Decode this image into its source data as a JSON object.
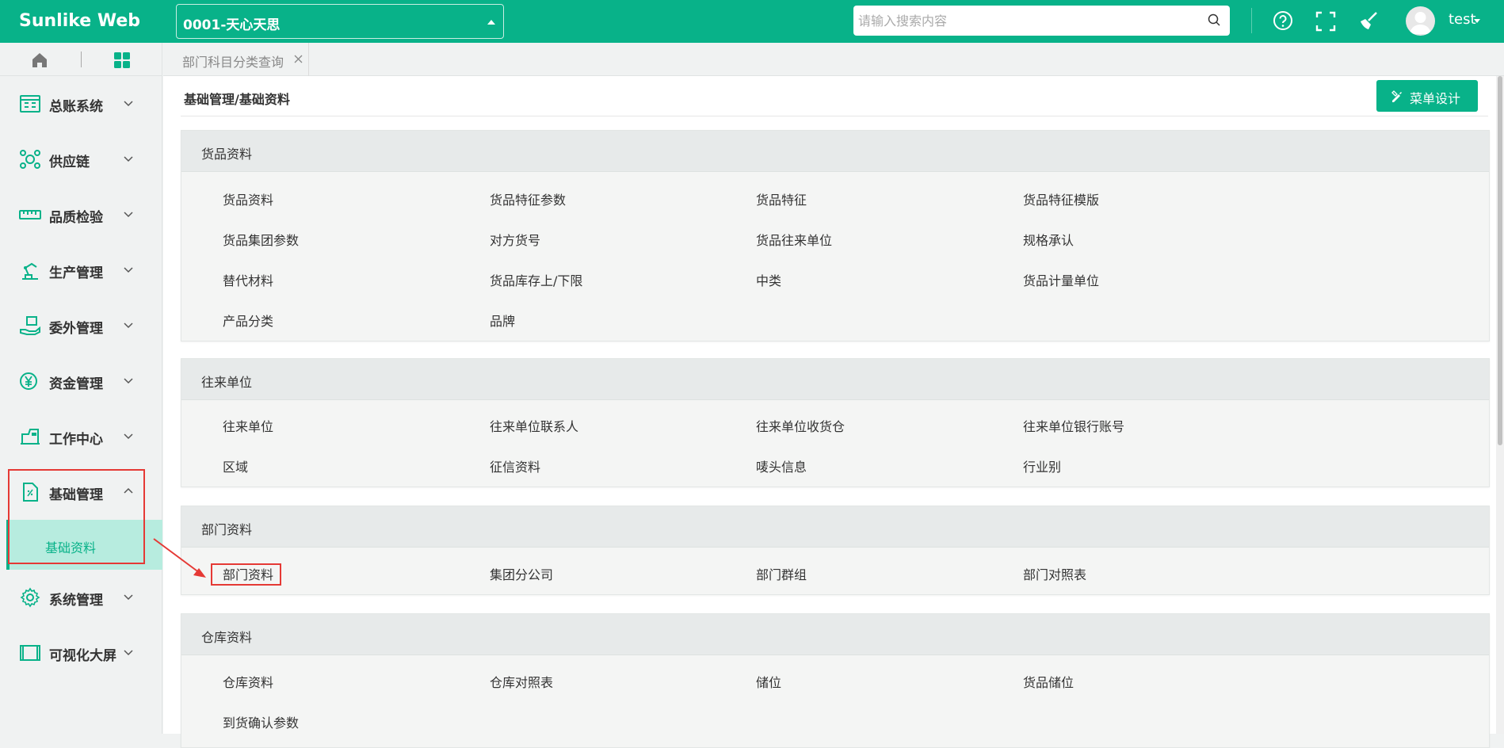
{
  "header": {
    "logo": "Sunlike Web",
    "org_select": "0001-天心天思",
    "search_placeholder": "请输入搜索内容",
    "username": "test"
  },
  "sidebar": {
    "menu": [
      {
        "label": "总账系统",
        "icon": "ledger-icon"
      },
      {
        "label": "供应链",
        "icon": "supply-chain-icon"
      },
      {
        "label": "品质检验",
        "icon": "ruler-icon"
      },
      {
        "label": "生产管理",
        "icon": "robot-arm-icon"
      },
      {
        "label": "委外管理",
        "icon": "hand-package-icon"
      },
      {
        "label": "资金管理",
        "icon": "yen-icon"
      },
      {
        "label": "工作中心",
        "icon": "machine-icon"
      },
      {
        "label": "基础管理",
        "icon": "document-icon"
      },
      {
        "label": "系统管理",
        "icon": "gear-icon"
      },
      {
        "label": "可视化大屏",
        "icon": "screen-icon"
      }
    ],
    "active_sub": "基础资料"
  },
  "tabs": [
    {
      "label": "部门科目分类查询"
    }
  ],
  "main": {
    "breadcrumb": "基础管理/基础资料",
    "design_button": "菜单设计",
    "sections": [
      {
        "title": "货品资料",
        "items": [
          "货品资料",
          "货品特征参数",
          "货品特征",
          "货品特征模版",
          "货品集团参数",
          "对方货号",
          "货品往来单位",
          "规格承认",
          "替代材料",
          "货品库存上/下限",
          "中类",
          "货品计量单位",
          "产品分类",
          "品牌"
        ]
      },
      {
        "title": "往来单位",
        "items": [
          "往来单位",
          "往来单位联系人",
          "往来单位收货仓",
          "往来单位银行账号",
          "区域",
          "征信资料",
          "唛头信息",
          "行业别"
        ]
      },
      {
        "title": "部门资料",
        "items": [
          "部门资料",
          "集团分公司",
          "部门群组",
          "部门对照表"
        ]
      },
      {
        "title": "仓库资料",
        "items": [
          "仓库资料",
          "仓库对照表",
          "储位",
          "货品储位",
          "到货确认参数"
        ]
      }
    ]
  },
  "colors": {
    "accent": "#08b289",
    "highlight": "#e53935"
  }
}
